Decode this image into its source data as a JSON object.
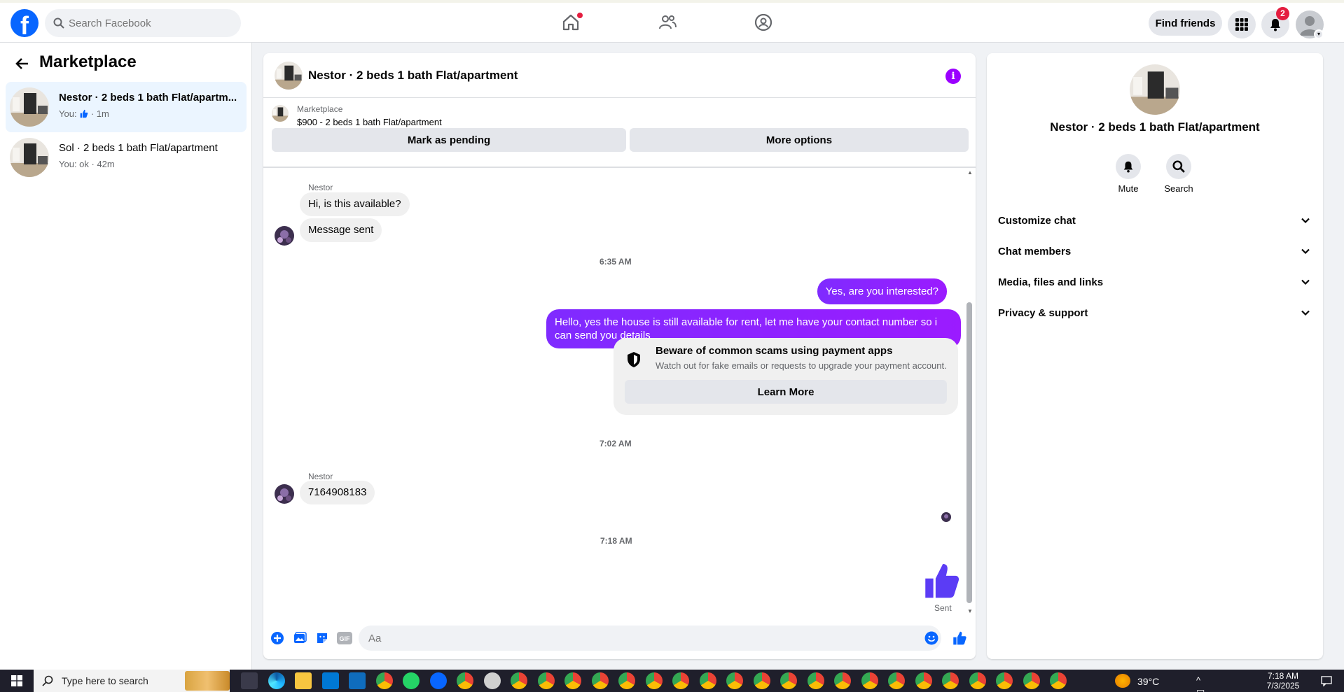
{
  "topbar": {
    "search_placeholder": "Search Facebook",
    "find_friends_label": "Find friends",
    "notification_count": "2",
    "brand_color": "#0866ff"
  },
  "sidebar": {
    "title": "Marketplace",
    "conversations": [
      {
        "name": "Nestor · 2 beds 1 bath Flat/apartm...",
        "preview_prefix": "You:",
        "preview_suffix": "· 1m",
        "active": true
      },
      {
        "name": "Sol · 2 beds 1 bath Flat/apartment",
        "preview": "You: ok · 42m",
        "active": false
      }
    ]
  },
  "chat": {
    "title": "Nestor · 2 beds 1 bath Flat/apartment",
    "listing_label": "Marketplace",
    "listing_price": "$900 - 2 beds 1 bath Flat/apartment",
    "mark_pending_label": "Mark as pending",
    "more_options_label": "More options",
    "messages": {
      "sender_1": "Nestor",
      "in_1": "Hi, is this available?",
      "in_2": "Message sent",
      "time_1": "6:35 AM",
      "out_1": "Yes, are you interested?",
      "out_2": "Hello, yes the house is still available for rent, let me have your contact number so i can send you details",
      "scam_title": "Beware of common scams using payment apps",
      "scam_sub": "Watch out for fake emails or requests to upgrade your payment account.",
      "scam_button": "Learn More",
      "time_2": "7:02 AM",
      "sender_2": "Nestor",
      "in_3": "7164908183",
      "time_3": "7:18 AM",
      "sent_status": "Sent"
    },
    "composer_placeholder": "Aa",
    "accent_color": "#9b00ff",
    "gif_label": "GIF"
  },
  "right_panel": {
    "title": "Nestor · 2 beds 1 bath Flat/apartment",
    "mute_label": "Mute",
    "search_label": "Search",
    "rows": [
      "Customize chat",
      "Chat members",
      "Media, files and links",
      "Privacy & support"
    ]
  },
  "taskbar": {
    "search_placeholder": "Type here to search",
    "temperature": "39°C",
    "time": "7:18 AM",
    "date": "7/3/2025"
  }
}
